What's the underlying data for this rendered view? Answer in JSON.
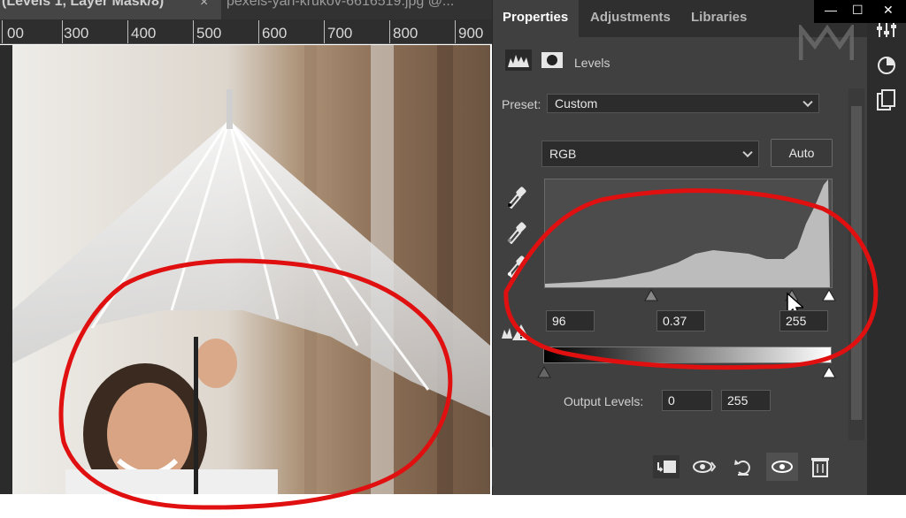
{
  "document_tabs": [
    {
      "label": "(Levels 1, Layer Mask/8)",
      "close": "×"
    },
    {
      "label": "pexels-yan-krukov-6616519.jpg @..."
    }
  ],
  "ruler": {
    "labels": [
      "300",
      "400",
      "500",
      "600",
      "700",
      "800",
      "900"
    ],
    "partial_label": "00"
  },
  "panel": {
    "tabs": [
      "Properties",
      "Adjustments",
      "Libraries"
    ],
    "active_tab": "Properties",
    "header_title": "Levels",
    "preset_label": "Preset:",
    "preset_value": "Custom",
    "channel_value": "RGB",
    "auto_button": "Auto",
    "input_levels": {
      "shadow": "96",
      "midtone": "0.37",
      "highlight": "255"
    },
    "output_label": "Output Levels:",
    "output_levels": {
      "black": "0",
      "white": "255"
    }
  },
  "window_controls": {
    "minimize": "—",
    "maximize": "☐",
    "close": "✕"
  },
  "colors": {
    "annotation": "#e01010",
    "panel_bg": "#404040",
    "tab_bg": "#2f2f2f"
  },
  "icons": [
    "histogram-icon",
    "mask-icon",
    "eyedropper-black-icon",
    "eyedropper-gray-icon",
    "eyedropper-white-icon",
    "warning-histogram-icon",
    "clip-to-layer-icon",
    "view-previous-icon",
    "reset-icon",
    "visibility-icon",
    "trash-icon",
    "adjustments-icon",
    "color-wheel-icon",
    "layers-copy-icon"
  ]
}
